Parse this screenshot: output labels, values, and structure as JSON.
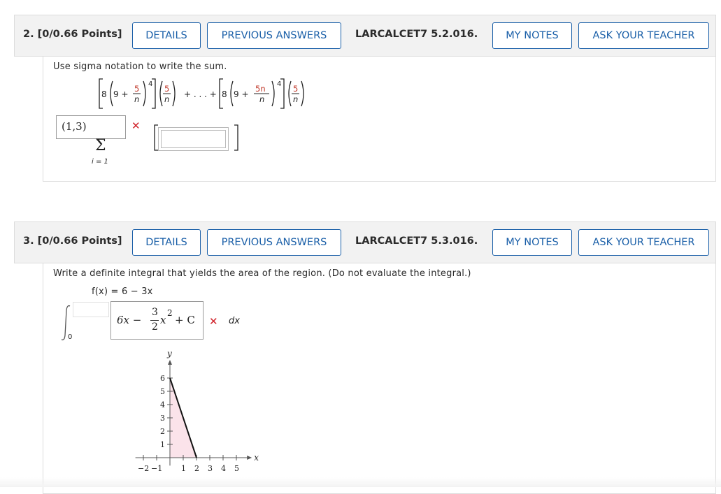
{
  "questions": [
    {
      "number_label": "2. [0/0.66 Points]",
      "details_label": "DETAILS",
      "previous_answers_label": "PREVIOUS ANSWERS",
      "code": "LARCALCET7 5.2.016.",
      "my_notes_label": "MY NOTES",
      "ask_teacher_label": "ASK YOUR TEACHER",
      "prompt": "Use sigma notation to write the sum.",
      "expression": {
        "coef": "8",
        "base": "9 +",
        "first_num": "5",
        "den": "n",
        "last_num": "5n",
        "exponent": "4",
        "factor_num": "5",
        "factor_den": "n",
        "ellipsis": "+ . . . +"
      },
      "sigma_upper_answer": "(1,3)",
      "sigma_symbol": "Σ",
      "sigma_lower": "i = 1",
      "status": "incorrect"
    },
    {
      "number_label": "3. [0/0.66 Points]",
      "details_label": "DETAILS",
      "previous_answers_label": "PREVIOUS ANSWERS",
      "code": "LARCALCET7 5.3.016.",
      "my_notes_label": "MY NOTES",
      "ask_teacher_label": "ASK YOUR TEACHER",
      "prompt": "Write a definite integral that yields the area of the region. (Do not evaluate the integral.)",
      "function_label": "f(x) = 6 − 3x",
      "lower_limit": "0",
      "integrand_answer": {
        "lead": "6x −",
        "frac_num": "3",
        "frac_den": "2",
        "tail": "x",
        "power": "2",
        "constant": "+ C"
      },
      "dx_label": "dx",
      "status": "incorrect",
      "graph": {
        "y_axis_label": "y",
        "x_axis_label": "x",
        "y_ticks": [
          "1",
          "2",
          "3",
          "4",
          "5",
          "6"
        ],
        "x_ticks": [
          "−2",
          "−1",
          "1",
          "2",
          "3",
          "4",
          "5"
        ],
        "line_points": [
          [
            0,
            6
          ],
          [
            2,
            0
          ]
        ],
        "shade_color": "#fbe3ea"
      }
    }
  ],
  "colors": {
    "accent": "#1a5fa8",
    "error": "#d0222a",
    "header_bg": "#f2f2f2"
  }
}
